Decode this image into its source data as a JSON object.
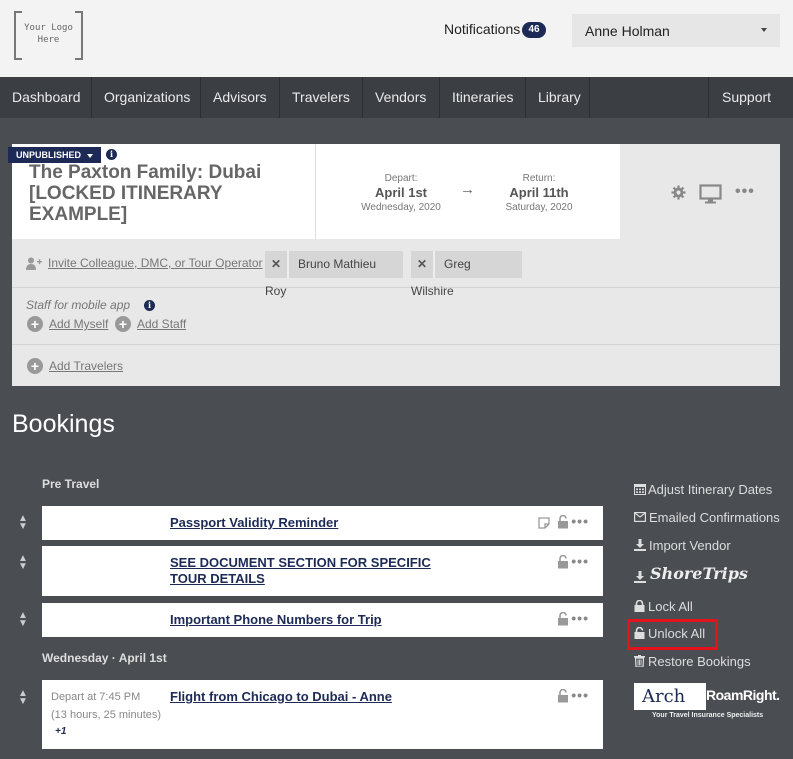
{
  "header": {
    "logo_text": "Your Logo Here",
    "notifications_label": "Notifications",
    "notifications_count": "46",
    "user_name": "Anne Holman"
  },
  "nav": {
    "items": [
      "Dashboard",
      "Organizations",
      "Advisors",
      "Travelers",
      "Vendors",
      "Itineraries",
      "Library"
    ],
    "support": "Support"
  },
  "itinerary": {
    "status": "UNPUBLISHED",
    "title": "The Paxton Family: Dubai [LOCKED ITINERARY EXAMPLE]",
    "depart": {
      "label": "Depart:",
      "date": "April 1st",
      "sub": "Wednesday, 2020"
    },
    "return": {
      "label": "Return:",
      "date": "April 11th",
      "sub": "Saturday, 2020"
    },
    "arrow": "→",
    "invite_link": "Invite Colleague, DMC, or Tour Operator",
    "collaborators": [
      "Bruno Mathieu Roy",
      "Greg Wilshire"
    ],
    "staff_label": "Staff for mobile app",
    "add_myself": "Add Myself",
    "add_staff": "Add Staff",
    "add_travelers": "Add Travelers"
  },
  "bookings": {
    "title": "Bookings",
    "sections": [
      {
        "label": "Pre Travel"
      },
      {
        "label": "Wednesday · April 1st"
      }
    ],
    "items": [
      {
        "title": "Passport Validity Reminder"
      },
      {
        "title": "SEE DOCUMENT SECTION FOR SPECIFIC TOUR DETAILS"
      },
      {
        "title": "Important Phone Numbers for Trip"
      },
      {
        "title": "Flight from Chicago to Dubai - Anne",
        "time": "Depart at 7:45 PM",
        "duration": "(13 hours, 25 minutes)",
        "day_offset": "+1"
      }
    ]
  },
  "actions": {
    "adjust_dates": "Adjust Itinerary Dates",
    "emailed": "Emailed Confirmations",
    "import_vendor": "Import Vendor",
    "shoretrips": "ShoreTrips",
    "lock_all": "Lock All",
    "unlock_all": "Unlock All",
    "restore": "Restore Bookings",
    "arch_brand": "Arch",
    "roam_brand": "RoamRight.",
    "roam_tagline": "Your Travel Insurance Specialists"
  },
  "colors": {
    "navy": "#1c2a55",
    "highlight": "#e3131b",
    "background": "#4a4e53"
  }
}
